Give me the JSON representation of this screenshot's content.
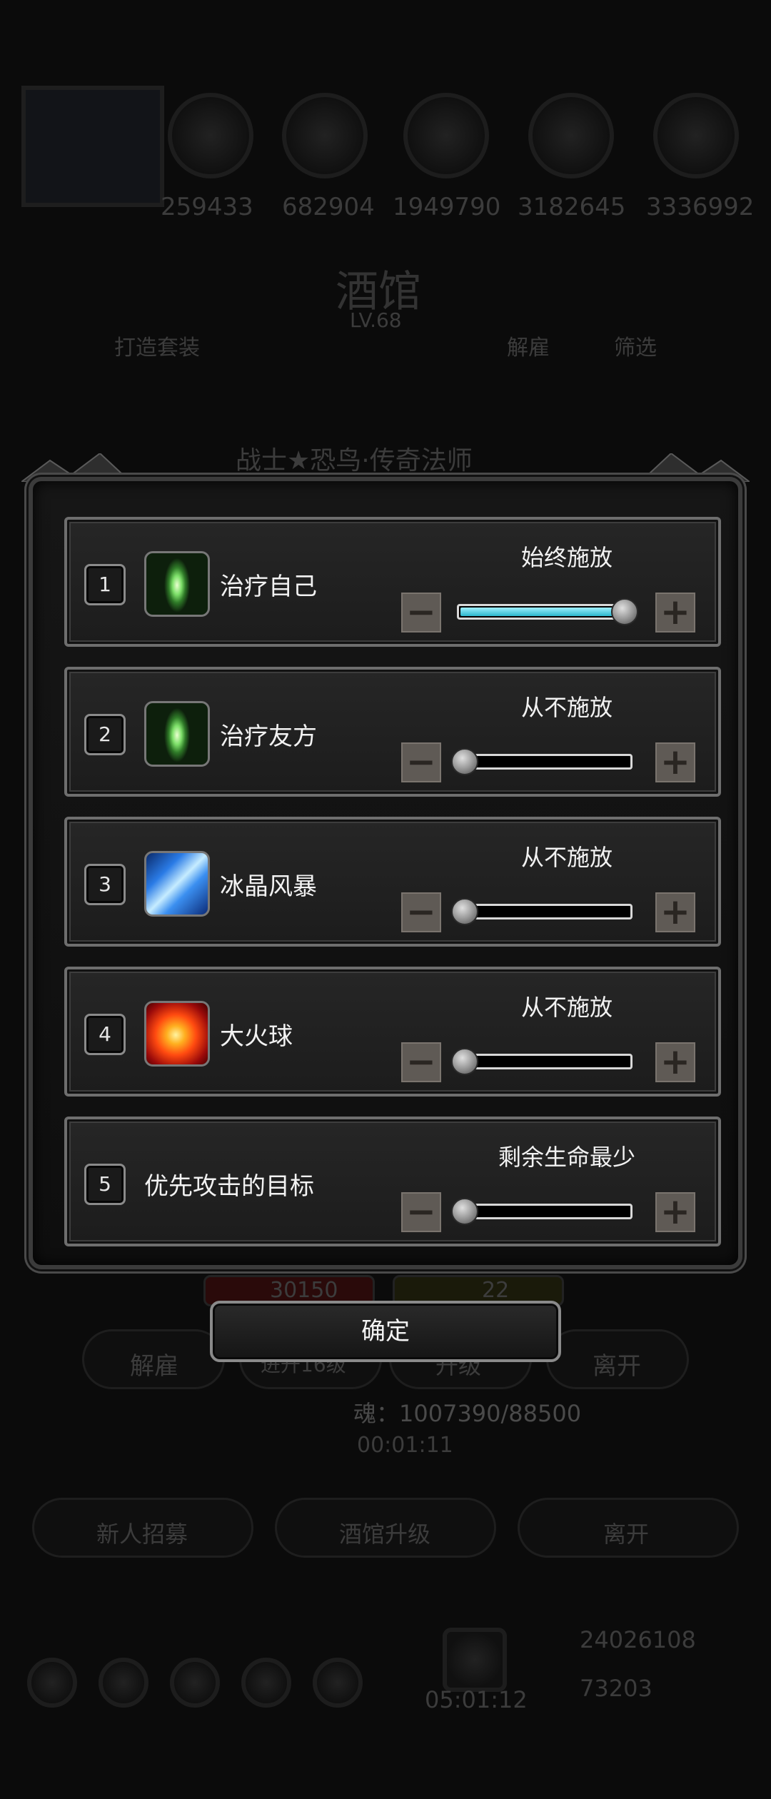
{
  "background": {
    "hero_powers": [
      "259433",
      "682904",
      "1949790",
      "3182645",
      "3336992"
    ],
    "tavern_title": "酒馆",
    "tavern_level": "LV.68",
    "left_tab": "打造套装",
    "right_tab_dismiss": "解雇",
    "right_tab_filter": "筛选",
    "hero_name": "战士★恐鸟·传奇法师",
    "hp_value": "30150",
    "energy_value": "22",
    "btn_dismiss": "解雇",
    "btn_promote": "进升16级",
    "btn_upgrade": "升级",
    "btn_leave": "离开",
    "soul_text": "魂：1007390/88500",
    "timer": "00:01:11",
    "btn_recruit": "新人招募",
    "btn_tavern_upgrade": "酒馆升级",
    "btn_leave2": "离开",
    "gold": "24026108",
    "gems": "73203",
    "gift_timer": "05:01:12"
  },
  "dialog": {
    "rows": [
      {
        "num": "1",
        "icon": "heal-skill-icon",
        "name": "治疗自己",
        "mode": "始终施放",
        "level": 1.0
      },
      {
        "num": "2",
        "icon": "heal-skill-icon",
        "name": "治疗友方",
        "mode": "从不施放",
        "level": 0.0
      },
      {
        "num": "3",
        "icon": "ice-storm-skill-icon",
        "name": "冰晶风暴",
        "mode": "从不施放",
        "level": 0.0
      },
      {
        "num": "4",
        "icon": "fireball-skill-icon",
        "name": "大火球",
        "mode": "从不施放",
        "level": 0.0
      },
      {
        "num": "5",
        "name": "优先攻击的目标",
        "mode": "剩余生命最少",
        "level": 0.0
      }
    ],
    "minus_symbol": "−",
    "plus_symbol": "+",
    "confirm_label": "确定"
  },
  "colors": {
    "slider_fill": "#2bb6cc",
    "frame": "#6e6e6e"
  }
}
